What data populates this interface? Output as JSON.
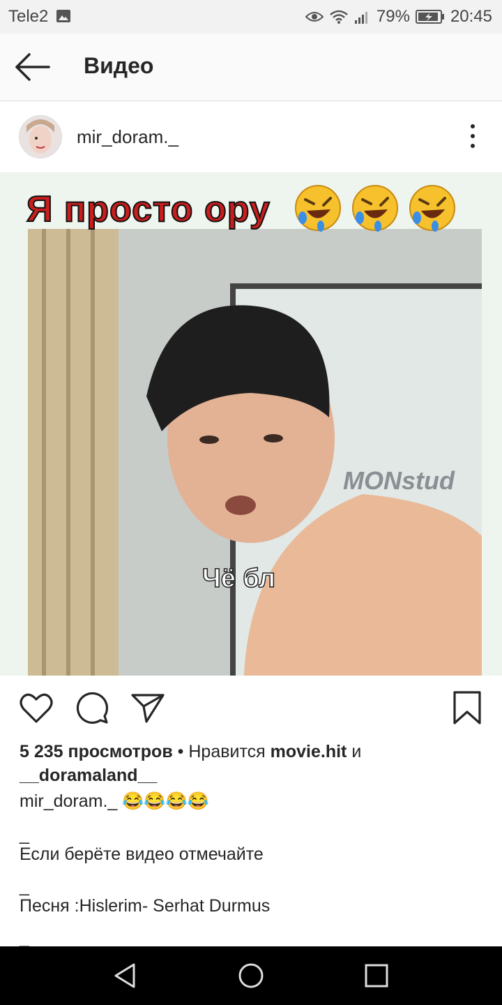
{
  "status_bar": {
    "carrier": "Tele2",
    "battery": "79%",
    "time": "20:45"
  },
  "app_bar": {
    "title": "Видео"
  },
  "post": {
    "username": "mir_doram._",
    "media_caption": "Я просто ору",
    "media_emoji_count": 3,
    "media_subtitle": "Чё бл",
    "media_watermark": "MONstud"
  },
  "meta": {
    "views": "5 235 просмотров",
    "separator": " • ",
    "likes_prefix": "Нравится ",
    "liked_by_1": "movie.hit",
    "conjunction": " и ",
    "liked_by_2": "__doramaland__"
  },
  "caption": {
    "username": "mir_doram._",
    "emojis": " 😂😂😂😂",
    "dash_1": "_",
    "line_1": "Если берёте видео отмечайте",
    "dash_2": "_",
    "line_2": "Песня :Hislerim- Serhat Durmus",
    "dash_3": "_"
  },
  "colors": {
    "caption_red": "#c81e1e",
    "text": "#262626",
    "nav_bar": "#000000"
  }
}
